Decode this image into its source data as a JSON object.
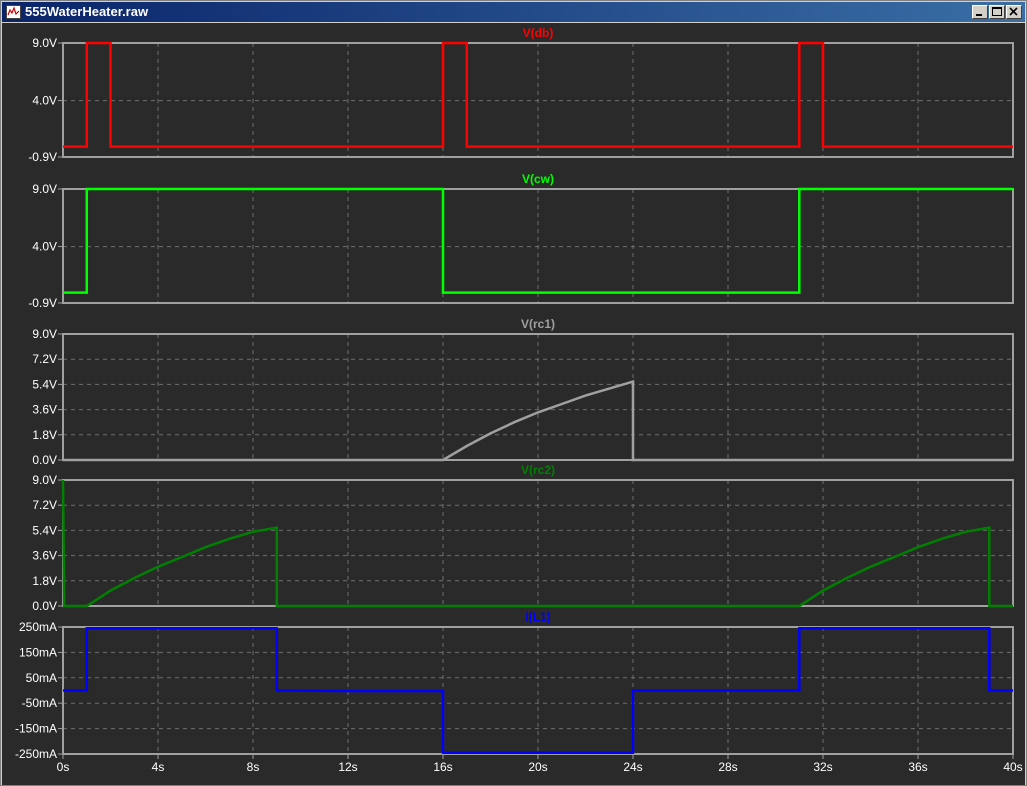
{
  "window": {
    "title": "555WaterHeater.raw",
    "icon": "waveform-plot-icon",
    "controls": {
      "minimize": "minimize-icon",
      "maximize": "maximize-icon",
      "close": "close-icon"
    }
  },
  "colors": {
    "background": "#2a2a2a",
    "frame": "#a0a0a0",
    "grid": "#6e6e6e",
    "text": "#ffffff",
    "titlebar_start": "#0a246a",
    "titlebar_end": "#3a6ea5"
  },
  "chart_data": [
    {
      "type": "line",
      "title": "V(db)",
      "color": "#ff0000",
      "xlim": [
        0,
        40
      ],
      "ylim": [
        -0.9,
        9.0
      ],
      "yticks": [
        9.0,
        4.0,
        -0.9
      ],
      "ytick_labels": [
        "9.0V",
        "4.0V",
        "-0.9V"
      ],
      "grid": true,
      "series": [
        {
          "x": [
            0,
            1,
            1,
            2,
            2,
            16,
            16,
            17,
            17,
            31,
            31,
            32,
            32,
            40
          ],
          "y": [
            0,
            0,
            9,
            9,
            0,
            0,
            9,
            9,
            0,
            0,
            9,
            9,
            0,
            0
          ]
        }
      ]
    },
    {
      "type": "line",
      "title": "V(cw)",
      "color": "#00ff00",
      "xlim": [
        0,
        40
      ],
      "ylim": [
        -0.9,
        9.0
      ],
      "yticks": [
        9.0,
        4.0,
        -0.9
      ],
      "ytick_labels": [
        "9.0V",
        "4.0V",
        "-0.9V"
      ],
      "grid": true,
      "series": [
        {
          "x": [
            0,
            1,
            1,
            16,
            16,
            31,
            31,
            40
          ],
          "y": [
            0,
            0,
            9,
            9,
            0,
            0,
            9,
            9
          ]
        }
      ]
    },
    {
      "type": "line",
      "title": "V(rc1)",
      "color": "#a0a0a0",
      "xlim": [
        0,
        40
      ],
      "ylim": [
        0,
        9.0
      ],
      "yticks": [
        9.0,
        7.2,
        5.4,
        3.6,
        1.8,
        0.0
      ],
      "ytick_labels": [
        "9.0V",
        "7.2V",
        "5.4V",
        "3.6V",
        "1.8V",
        "0.0V"
      ],
      "grid": true,
      "series": [
        {
          "x": [
            0,
            16,
            17,
            18,
            19,
            20,
            21,
            22,
            23,
            24,
            24,
            40
          ],
          "y": [
            0,
            0,
            1.0,
            1.9,
            2.7,
            3.4,
            4.0,
            4.6,
            5.1,
            5.6,
            0,
            0
          ]
        }
      ]
    },
    {
      "type": "line",
      "title": "V(rc2)",
      "color": "#008000",
      "xlim": [
        0,
        40
      ],
      "ylim": [
        0,
        9.0
      ],
      "yticks": [
        9.0,
        7.2,
        5.4,
        3.6,
        1.8,
        0.0
      ],
      "ytick_labels": [
        "9.0V",
        "7.2V",
        "5.4V",
        "3.6V",
        "1.8V",
        "0.0V"
      ],
      "grid": true,
      "series": [
        {
          "x": [
            0,
            0.05,
            1,
            2,
            3,
            4,
            5,
            6,
            7,
            8,
            9,
            9,
            31,
            32,
            33,
            34,
            35,
            36,
            37,
            38,
            39,
            39,
            40
          ],
          "y": [
            9.0,
            0,
            0,
            1.1,
            2.0,
            2.8,
            3.5,
            4.2,
            4.8,
            5.3,
            5.6,
            0,
            0,
            1.1,
            2.0,
            2.8,
            3.5,
            4.2,
            4.8,
            5.3,
            5.6,
            0,
            0
          ]
        }
      ]
    },
    {
      "type": "line",
      "title": "I(L1)",
      "color": "#0000ff",
      "xlim": [
        0,
        40
      ],
      "ylim": [
        -250,
        250
      ],
      "yticks": [
        250,
        150,
        50,
        -50,
        -150,
        -250
      ],
      "ytick_labels": [
        "250mA",
        "150mA",
        "50mA",
        "-50mA",
        "-150mA",
        "-250mA"
      ],
      "xticks": [
        0,
        4,
        8,
        12,
        16,
        20,
        24,
        28,
        32,
        36,
        40
      ],
      "xtick_labels": [
        "0s",
        "4s",
        "8s",
        "12s",
        "16s",
        "20s",
        "24s",
        "28s",
        "32s",
        "36s",
        "40s"
      ],
      "grid": true,
      "series": [
        {
          "x": [
            0,
            1,
            1,
            9,
            9,
            12,
            16,
            16,
            24,
            24,
            31,
            31,
            39,
            39,
            40
          ],
          "y": [
            0,
            0,
            245,
            245,
            0,
            -2,
            -2,
            -245,
            -245,
            0,
            0,
            245,
            245,
            0,
            0
          ]
        }
      ]
    }
  ]
}
